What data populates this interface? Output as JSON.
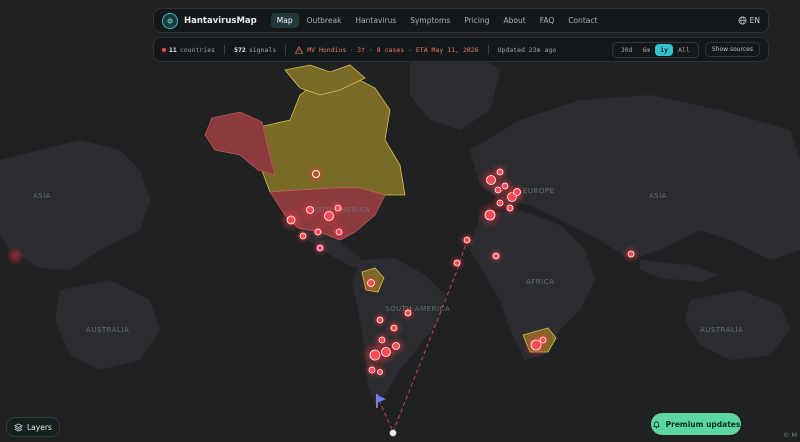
{
  "navbar": {
    "logo_text": "HantavirusMap",
    "items": [
      "Map",
      "Outbreak",
      "Hantavirus",
      "Symptoms",
      "Pricing",
      "About",
      "FAQ",
      "Contact"
    ],
    "active_item": "Map",
    "language": "EN"
  },
  "status": {
    "countries_count": "11",
    "countries_label": "countries",
    "signals_count": "572",
    "signals_label": "signals",
    "ship_name": "MV Hondius",
    "ship_details": "· 3† · 8 cases · ETA May 11, 2026",
    "updated": "Updated 23m ago",
    "periods": [
      "30d",
      "6m",
      "1y",
      "All"
    ],
    "active_period": "1y",
    "show_sources": "Show sources"
  },
  "map_labels": {
    "asia": "ASIA",
    "north_america": "NORTH AMERICA",
    "europe": "EUROPE",
    "africa": "AFRICA",
    "south_america": "SOUTH AMERICA",
    "australia": "AUSTRALIA"
  },
  "layers_button": "Layers",
  "premium_button": "Premium updates",
  "attribution": "© M",
  "colors": {
    "map_background": "#1f2123",
    "land": "#2a2c2f",
    "highlight_yellow": "#7a6a28",
    "highlight_red": "#8c3a3e",
    "marker_red": "#ff4b57",
    "accent_teal": "#33c3d0",
    "premium_green": "#5cd6a3",
    "route_dashed": "#d94848"
  },
  "icons": {
    "logo": "virus-icon",
    "language": "globe-icon",
    "ship": "warning-triangle-icon",
    "layers": "layers-icon",
    "premium": "bell-icon",
    "ship_marker": "flag-icon"
  }
}
